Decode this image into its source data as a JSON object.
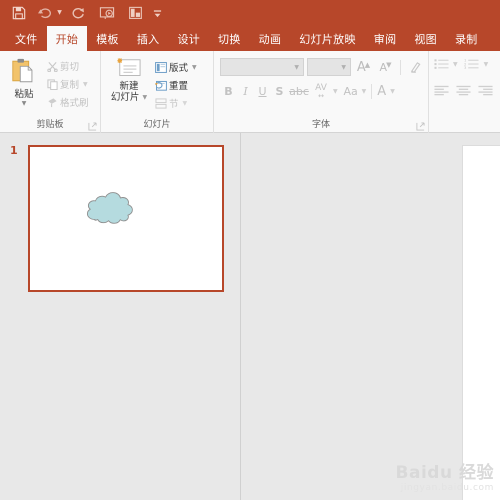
{
  "quick_access": {
    "buttons": [
      {
        "name": "save-button",
        "icon": "save-icon",
        "title": "保存"
      },
      {
        "name": "undo-button",
        "icon": "undo-icon",
        "title": "撤消",
        "caret": true
      },
      {
        "name": "redo-button",
        "icon": "redo-icon",
        "title": "恢复"
      },
      {
        "name": "start-slideshow-button",
        "icon": "slideshow-icon",
        "title": "从头开始"
      },
      {
        "name": "custom-layout-button",
        "icon": "layout-icon",
        "title": "自定义"
      }
    ],
    "more_label": "自定义快速访问工具栏"
  },
  "tabs": [
    {
      "label": "文件",
      "active": false
    },
    {
      "label": "开始",
      "active": true
    },
    {
      "label": "模板",
      "active": false
    },
    {
      "label": "插入",
      "active": false
    },
    {
      "label": "设计",
      "active": false
    },
    {
      "label": "切换",
      "active": false
    },
    {
      "label": "动画",
      "active": false
    },
    {
      "label": "幻灯片放映",
      "active": false
    },
    {
      "label": "审阅",
      "active": false
    },
    {
      "label": "视图",
      "active": false
    },
    {
      "label": "录制",
      "active": false
    }
  ],
  "ribbon": {
    "clipboard": {
      "group_label": "剪贴板",
      "paste_label": "粘贴",
      "cut_label": "剪切",
      "copy_label": "复制",
      "format_painter_label": "格式刷"
    },
    "slides": {
      "group_label": "幻灯片",
      "new_slide_line1": "新建",
      "new_slide_line2": "幻灯片",
      "layout_label": "版式",
      "reset_label": "重置",
      "section_label": "节"
    },
    "font": {
      "group_label": "字体",
      "font_name_value": "",
      "font_name_placeholder": "",
      "font_size_value": "",
      "font_size_placeholder": "",
      "grow_font": "A",
      "shrink_font": "A",
      "clear_formatting_label": "清除所有格式",
      "bold": "B",
      "italic": "I",
      "underline": "U",
      "shadow": "S",
      "strikethrough": "abc",
      "character_spacing": "AV",
      "change_case": "Aa",
      "font_color": "A"
    },
    "paragraph": {
      "group_label": "",
      "bullets_label": "项目符号",
      "numbering_label": "编号",
      "align_left_label": "左对齐",
      "align_center_label": "居中",
      "align_right_label": "右对齐"
    }
  },
  "slide_pane": {
    "slide_number": "1",
    "shape_name": "cloud-shape",
    "shape_fill": "#b5dbdf",
    "shape_stroke": "#8f8f8f",
    "thumb_border_color": "#b7472a"
  },
  "watermark": {
    "main": "Baidu 经验",
    "brand_left": "Bai",
    "brand_mid": "du",
    "brand_right": "经验",
    "sub": "jingyan.baidu.com"
  },
  "colors": {
    "ribbon_accent": "#b7472a",
    "ribbon_bg": "#f9f9f9",
    "app_bg": "#e8e8e8"
  }
}
